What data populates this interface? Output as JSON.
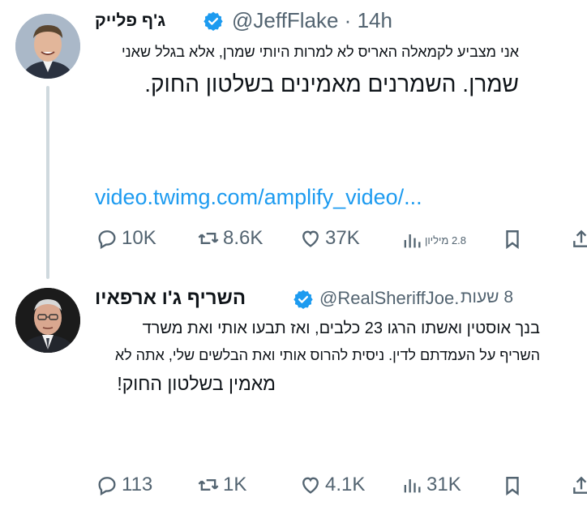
{
  "tweet1": {
    "name": "ג'ף פלייק",
    "handle": "@JeffFlake",
    "separator": "·",
    "time": "14h",
    "line1": "אני מצביע לקמאלה האריס לא למרות היותי שמרן, אלא בגלל שאני",
    "line2": "שמרן. השמרנים מאמינים בשלטון החוק.",
    "link": "video.twimg.com/amplify_video/...",
    "actions": {
      "replies": "10K",
      "reposts": "8.6K",
      "likes": "37K",
      "views": "2.8 מיליון"
    }
  },
  "tweet2": {
    "name": "השריף ג'ו ארפאיו",
    "handle": "@RealSheriffJoe.",
    "time": "8 שעות",
    "line1": "בנך אוסטין ואשתו הרגו 23 כלבים, ואז תבעו אותי ואת משרד",
    "line2": "השריף על העמדתם לדין. ניסית להרוס אותי ואת הבלשים שלי, אתה לא",
    "line3": "מאמין בשלטון החוק!",
    "actions": {
      "replies": "113",
      "reposts": "1K",
      "likes": "4.1K",
      "views": "31K"
    }
  },
  "colors": {
    "accent": "#1d9bf0",
    "text": "#0f1419",
    "muted": "#536471"
  },
  "icons": [
    "verified-badge-icon",
    "reply-icon",
    "repost-icon",
    "like-icon",
    "views-icon",
    "bookmark-icon",
    "share-icon"
  ]
}
